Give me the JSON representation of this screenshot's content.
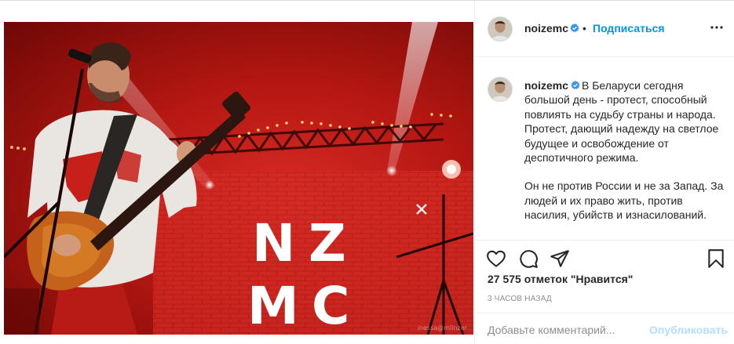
{
  "post": {
    "media": {
      "stage_letters": [
        "N",
        "Z",
        "M",
        "C"
      ],
      "watermark": "inessa@mlinzer"
    },
    "author": {
      "username": "noizemc",
      "verified": true,
      "avatar_icon": "profile-avatar-icon"
    },
    "header": {
      "separator": "•",
      "follow_label": "Подписаться",
      "more_icon": "more-options-icon"
    },
    "caption": {
      "username": "noizemc",
      "paragraph_1": "В Беларуси сегодня большой день - протест, способный повлиять на судьбу страны и народа. Протест, дающий надежду на светлое будущее и освобождение от деспотичного режима.",
      "paragraph_2": "Он не против России и не за Запад. За людей и их право жить, против насилия, убийств и изнасилований."
    },
    "actions": {
      "like_icon": "heart-icon",
      "comment_icon": "comment-icon",
      "share_icon": "share-icon",
      "save_icon": "bookmark-icon"
    },
    "likes_text": "27 575 отметок \"Нравится\"",
    "time_ago": "3 ЧАСОВ НАЗАД",
    "comment": {
      "placeholder": "Добавьте комментарий...",
      "publish_label": "Опубликовать"
    },
    "colors": {
      "link_blue": "#0095f6",
      "publish_disabled": "#b2dffc",
      "verified_blue": "#3897f0",
      "stage_red": "#c71f19"
    }
  }
}
